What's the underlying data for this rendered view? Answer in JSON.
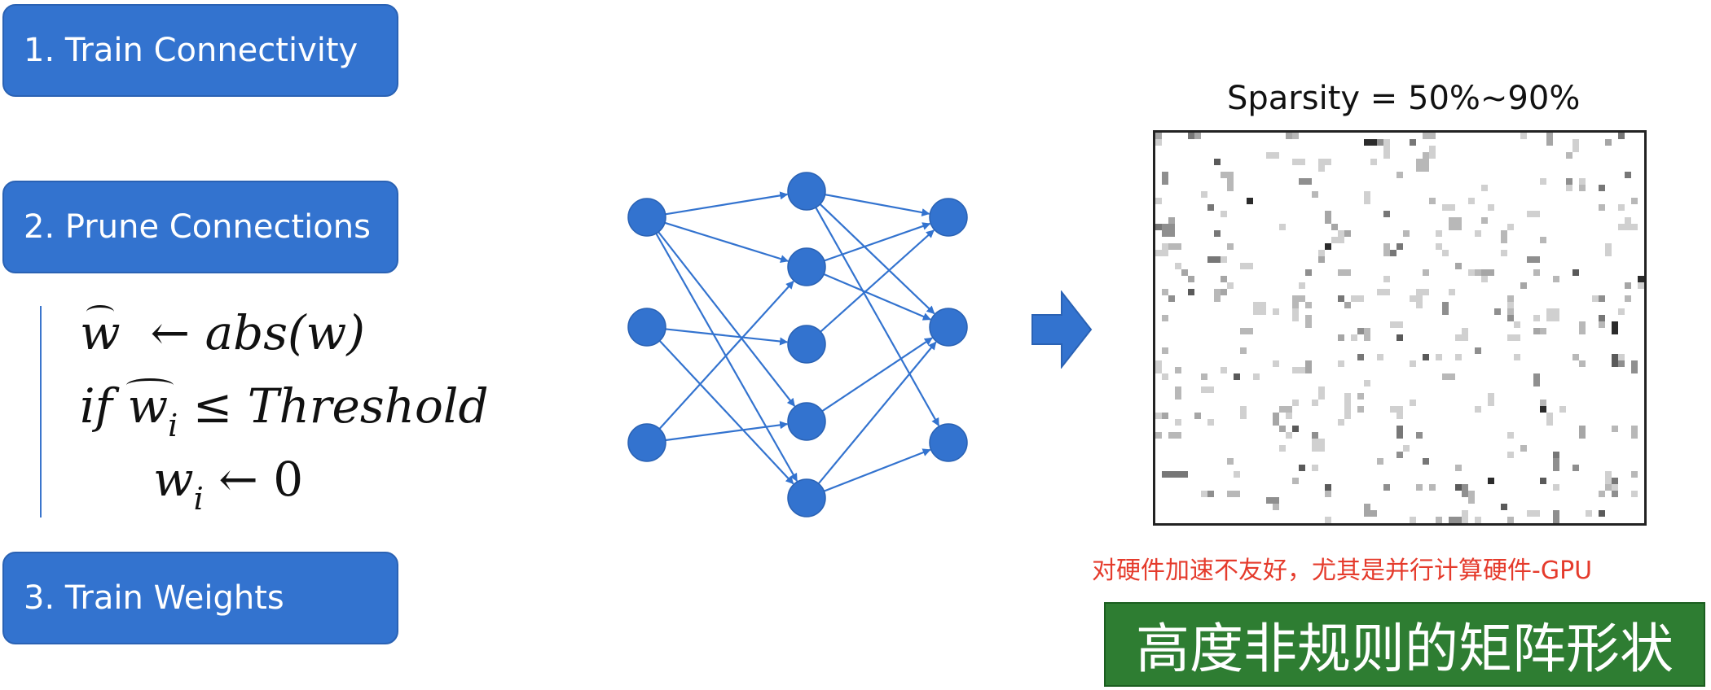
{
  "steps": {
    "train_connectivity": "1. Train Connectivity",
    "prune_connections": "2. Prune Connections",
    "train_weights": "3. Train Weights"
  },
  "formula": {
    "line1_w": "w",
    "line1_arrow": "←",
    "line1_rhs": "abs(w)",
    "line2_if": "if",
    "line2_w": "w",
    "line2_i": "i",
    "line2_op": "≤",
    "line2_threshold": "Threshold",
    "line3_w": "w",
    "line3_i": "i",
    "line3_arrow": "←",
    "line3_zero": "0"
  },
  "sparsity_label": "Sparsity = 50%~90%",
  "note": "对硬件加速不友好，尤其是并行计算硬件-GPU",
  "banner": "高度非规则的矩阵形状",
  "colors": {
    "step_blue": "#3373cf",
    "node_blue": "#3373cf",
    "note_red": "#e53b2c",
    "banner_green": "#2e7d32"
  }
}
